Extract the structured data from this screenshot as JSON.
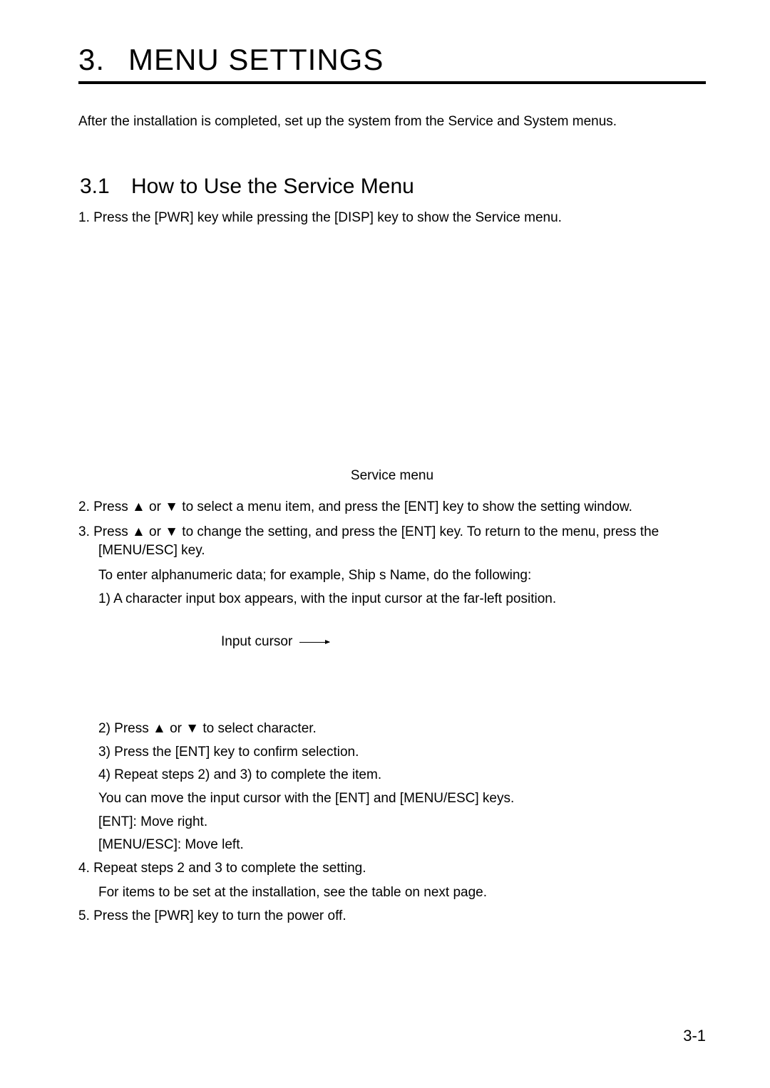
{
  "chapter": {
    "number": "3.",
    "title": "MENU SETTINGS"
  },
  "intro": "After the installation is completed, set up the system from the Service and System menus.",
  "section": {
    "number": "3.1",
    "title": "How to Use the Service Menu"
  },
  "steps": {
    "s1": "1. Press the [PWR] key while pressing the [DISP] key to show the Service menu.",
    "figure_caption": "Service menu",
    "s2": "2. Press ▲ or ▼ to select a menu item, and press the [ENT] key to show the setting window.",
    "s3": "3. Press ▲ or ▼ to change the setting, and press the [ENT] key. To return to the menu, press the [MENU/ESC] key.",
    "s3_note": "To enter alphanumeric data; for example, Ship s Name, do the following:",
    "s3_sub1": "1) A character input box appears, with the input cursor at the far-left position.",
    "input_cursor_label": "Input cursor",
    "s3_sub2": "2) Press ▲ or ▼ to select character.",
    "s3_sub3": "3) Press the [ENT] key to confirm selection.",
    "s3_sub4": "4) Repeat steps 2) and 3) to complete the item.",
    "s3_note2": "You can move the input cursor with the [ENT] and [MENU/ESC] keys.",
    "s3_note3": "[ENT]: Move right.",
    "s3_note4": "[MENU/ESC]: Move left.",
    "s4": "4. Repeat steps 2 and 3 to complete the setting.",
    "s4_note": "For items to be set at the installation, see the table on next page.",
    "s5": "5. Press the [PWR] key to turn the power off."
  },
  "page_number": "3-1"
}
